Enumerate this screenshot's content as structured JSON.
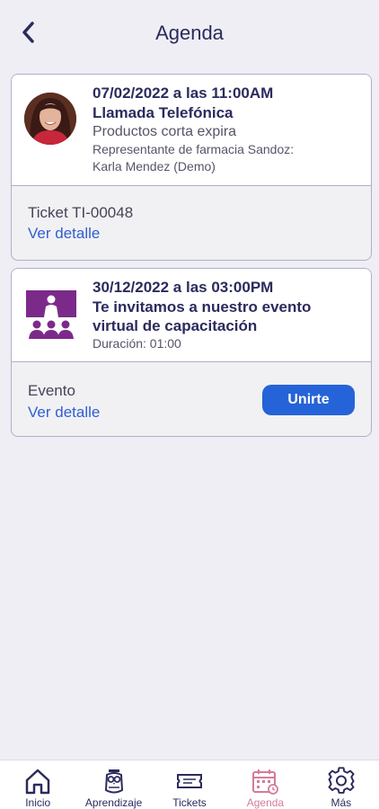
{
  "header": {
    "title": "Agenda",
    "back_icon": "chevron-left-icon"
  },
  "cards": [
    {
      "date": "07/02/2022 a las 11:00AM",
      "title": "Llamada Telefónica",
      "subtitle": "Productos corta expira",
      "detail_line1": "Representante de farmacia Sandoz:",
      "detail_line2": "Karla Mendez (Demo)",
      "footer_label": "Ticket TI-00048",
      "link": "Ver detalle"
    },
    {
      "date": "30/12/2022 a las 03:00PM",
      "title_line1": "Te invitamos a nuestro evento",
      "title_line2": "virtual de capacitación",
      "duration": "Duración: 01:00",
      "footer_label": "Evento",
      "link": "Ver detalle",
      "button": "Unirte",
      "icon": "training-event-icon"
    }
  ],
  "tabbar": [
    {
      "label": "Inicio",
      "icon": "home-icon"
    },
    {
      "label": "Aprendizaje",
      "icon": "owl-icon"
    },
    {
      "label": "Tickets",
      "icon": "ticket-icon"
    },
    {
      "label": "Agenda",
      "icon": "calendar-icon",
      "active": true
    },
    {
      "label": "Más",
      "icon": "gear-icon"
    }
  ],
  "colors": {
    "accent": "#2563d8",
    "active_tab": "#d57b9b",
    "event_icon": "#7b2a8a",
    "title": "#2b2b5e"
  }
}
